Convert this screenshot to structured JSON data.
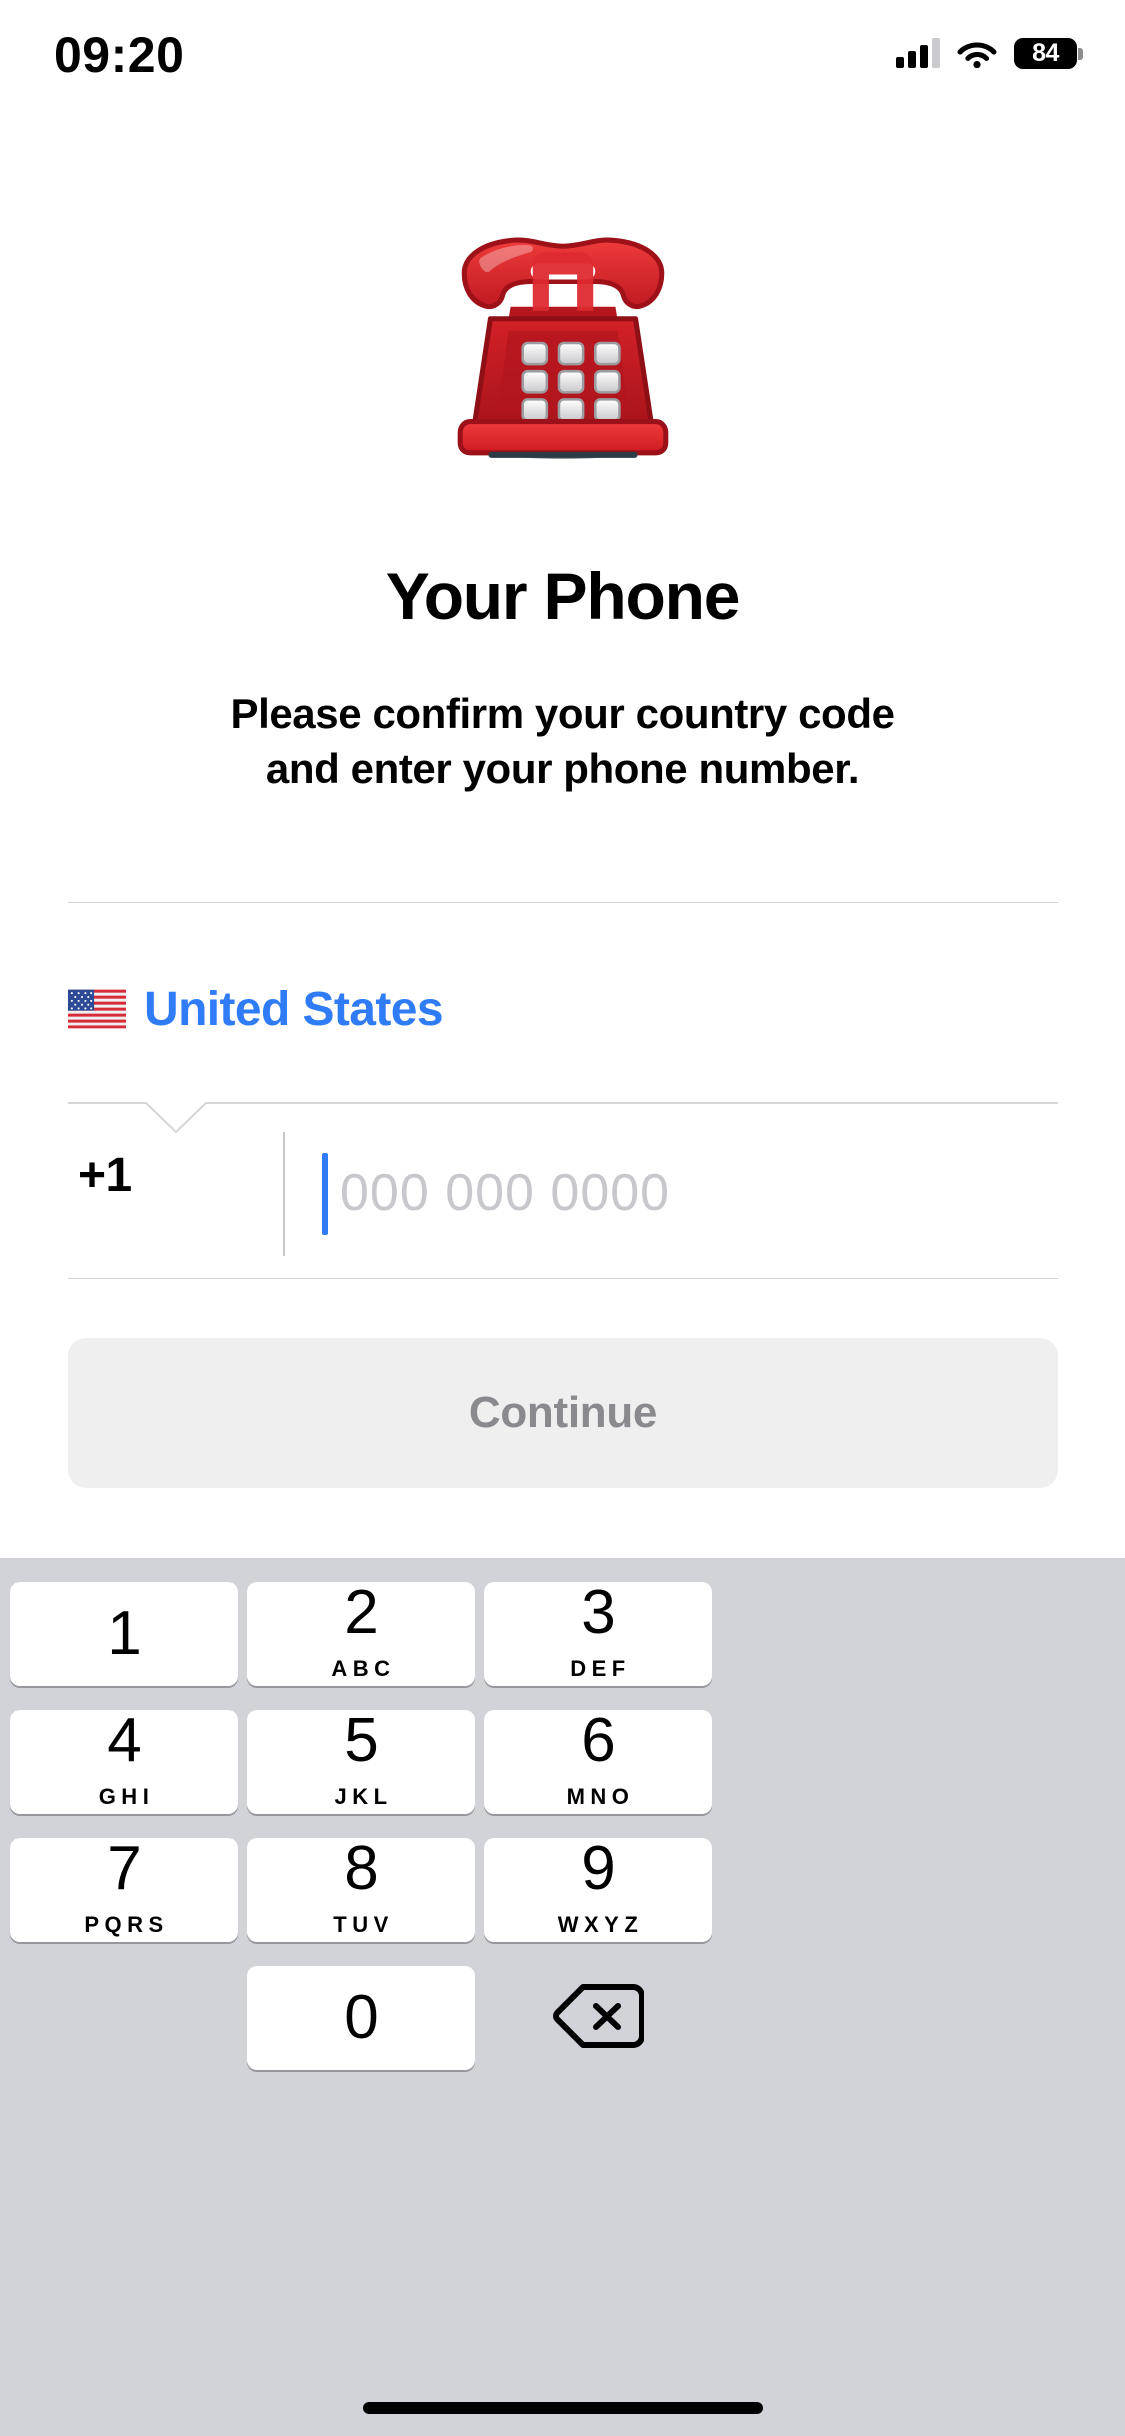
{
  "status_bar": {
    "time": "09:20",
    "battery_level": "84",
    "icons": [
      "signal-bars-icon",
      "wifi-icon",
      "battery-icon"
    ]
  },
  "hero": {
    "emoji": "☎️",
    "emoji_name": "telephone-emoji",
    "title": "Your Phone",
    "subtitle_line1": "Please confirm your country code",
    "subtitle_line2": "and enter your phone number."
  },
  "country": {
    "flag_emoji": "🇺🇸",
    "flag_name": "us-flag-emoji",
    "name": "United States",
    "accent_color": "#2f7cf6"
  },
  "phone": {
    "country_code": "+1",
    "value": "",
    "placeholder": "000 000 0000"
  },
  "actions": {
    "continue_label": "Continue",
    "continue_enabled": false
  },
  "keypad": {
    "background_color": "#d1d3d9",
    "keys": [
      {
        "digit": "1",
        "letters": ""
      },
      {
        "digit": "2",
        "letters": "ABC"
      },
      {
        "digit": "3",
        "letters": "DEF"
      },
      {
        "digit": "4",
        "letters": "GHI"
      },
      {
        "digit": "5",
        "letters": "JKL"
      },
      {
        "digit": "6",
        "letters": "MNO"
      },
      {
        "digit": "7",
        "letters": "PQRS"
      },
      {
        "digit": "8",
        "letters": "TUV"
      },
      {
        "digit": "9",
        "letters": "WXYZ"
      },
      {
        "digit": "0",
        "letters": ""
      }
    ],
    "delete_key": "delete-backspace-icon"
  }
}
